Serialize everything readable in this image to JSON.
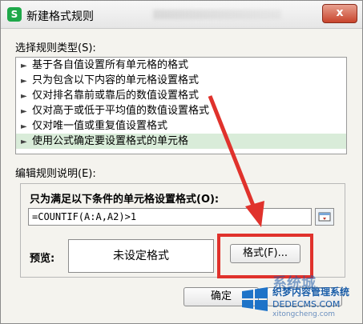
{
  "window": {
    "title": "新建格式规则",
    "app_icon_letter": "S",
    "close_label": "x"
  },
  "rule_type": {
    "label": "选择规则类型(S):",
    "items": [
      {
        "label": "基于各自值设置所有单元格的格式",
        "selected": false
      },
      {
        "label": "只为包含以下内容的单元格设置格式",
        "selected": false
      },
      {
        "label": "仅对排名靠前或靠后的数值设置格式",
        "selected": false
      },
      {
        "label": "仅对高于或低于平均值的数值设置格式",
        "selected": false
      },
      {
        "label": "仅对唯一值或重复值设置格式",
        "selected": false
      },
      {
        "label": "使用公式确定要设置格式的单元格",
        "selected": true
      }
    ]
  },
  "edit_rule": {
    "label": "编辑规则说明(E):",
    "formula_label": "只为满足以下条件的单元格设置格式(O):",
    "formula_value": "=COUNTIF(A:A,A2)>1",
    "preview_label": "预览:",
    "preview_text": "未设定格式",
    "format_button": "格式(F)..."
  },
  "buttons": {
    "ok": "确定"
  },
  "colors": {
    "annotation": "#e0322c",
    "selected_row": "#d9ecd9",
    "app_icon": "#1fa84a"
  },
  "watermark": {
    "brand": "系统城",
    "line1": "织梦内容管理系统",
    "line2": "DEDECMS.COM",
    "line3": "xitongcheng.com"
  }
}
